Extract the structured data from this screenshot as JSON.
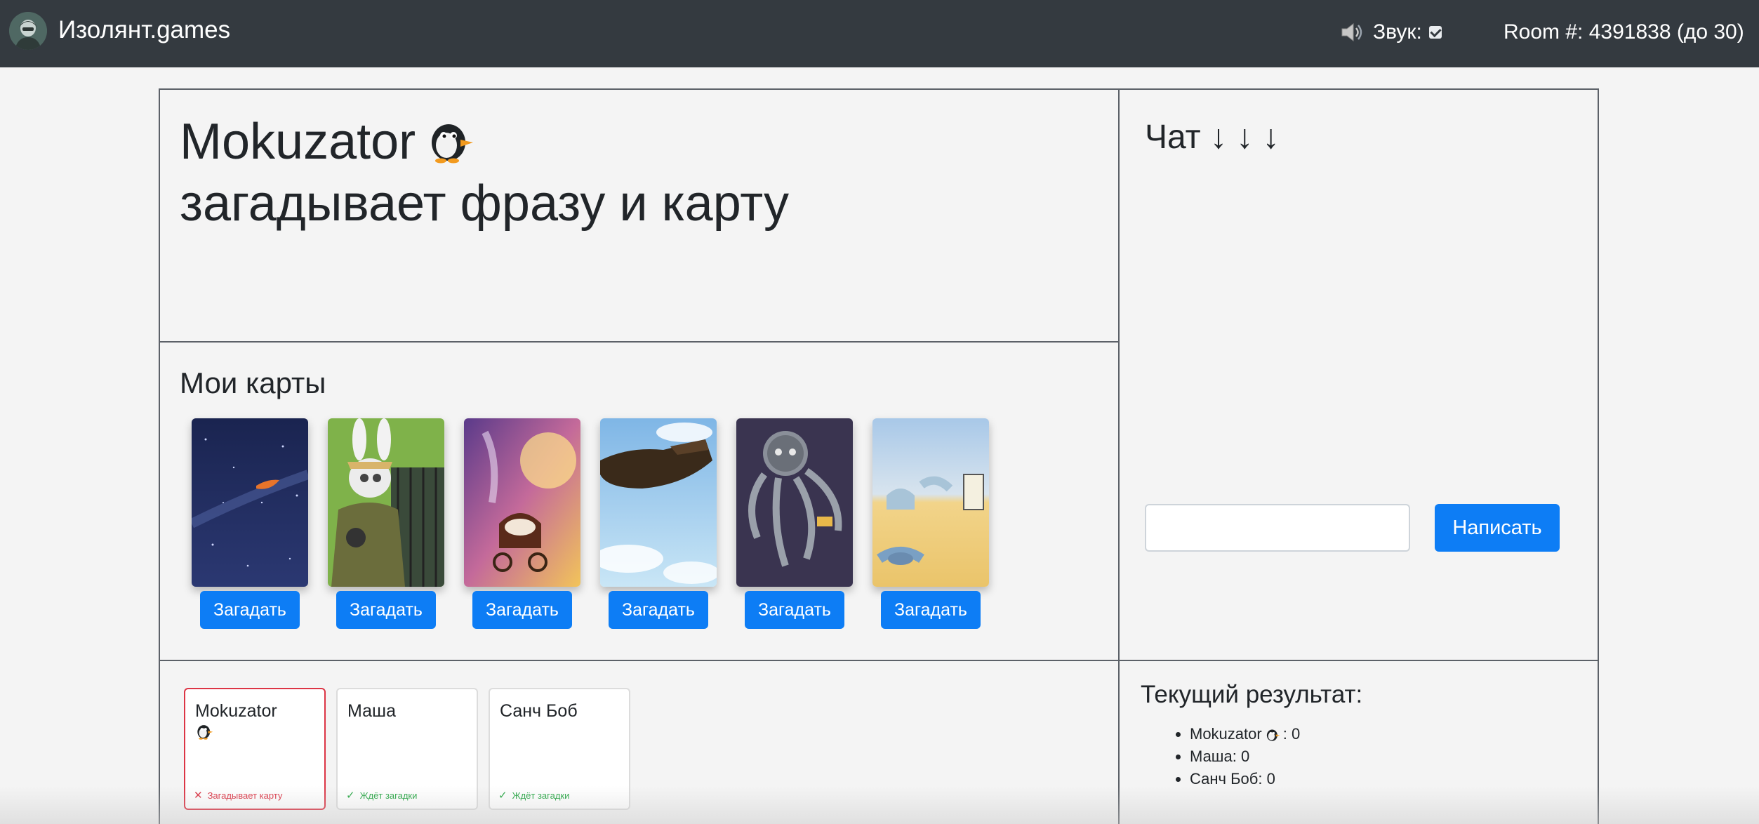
{
  "navbar": {
    "logo_icon": "avatar-logo-icon",
    "brand": "Изолянт.games",
    "sound_icon": "speaker-icon",
    "sound_label": "Звук:",
    "sound_enabled": true,
    "room": "Room #: 4391838 (до 30)"
  },
  "storyteller": {
    "name": "Mokuzator",
    "icon": "penguin-icon",
    "action": "загадывает фразу и карту"
  },
  "my_cards": {
    "title": "Мои карты",
    "cards": [
      {
        "image": "space-boat-card",
        "button": "Загадать"
      },
      {
        "image": "rabbit-soldier-card",
        "button": "Загадать"
      },
      {
        "image": "angels-stroller-card",
        "button": "Загадать"
      },
      {
        "image": "flying-boot-card",
        "button": "Загадать"
      },
      {
        "image": "robot-octopus-card",
        "button": "Загадать"
      },
      {
        "image": "desert-serpent-card",
        "button": "Загадать"
      }
    ]
  },
  "players": [
    {
      "name": "Mokuzator",
      "icon": "penguin-icon",
      "status": "Загадывает карту",
      "status_icon": "cross-icon",
      "state": "red"
    },
    {
      "name": "Маша",
      "status": "Ждёт загадки",
      "status_icon": "check-icon",
      "state": "green"
    },
    {
      "name": "Санч Боб",
      "status": "Ждёт загадки",
      "status_icon": "check-icon",
      "state": "green"
    }
  ],
  "chat": {
    "title": "Чат ↓ ↓ ↓",
    "input_value": "",
    "send_label": "Написать"
  },
  "score": {
    "title": "Текущий результат:",
    "entries": [
      {
        "name": "Mokuzator",
        "icon": "penguin-icon",
        "sep": ": ",
        "points": "0"
      },
      {
        "name": "Маша",
        "sep": ": ",
        "points": "0"
      },
      {
        "name": "Санч Боб",
        "sep": ": ",
        "points": "0"
      }
    ]
  },
  "colors": {
    "navbar": "#343a40",
    "primary": "#0d7df5",
    "danger": "#dc3545",
    "success": "#28a745",
    "background": "#f4f4f4"
  }
}
